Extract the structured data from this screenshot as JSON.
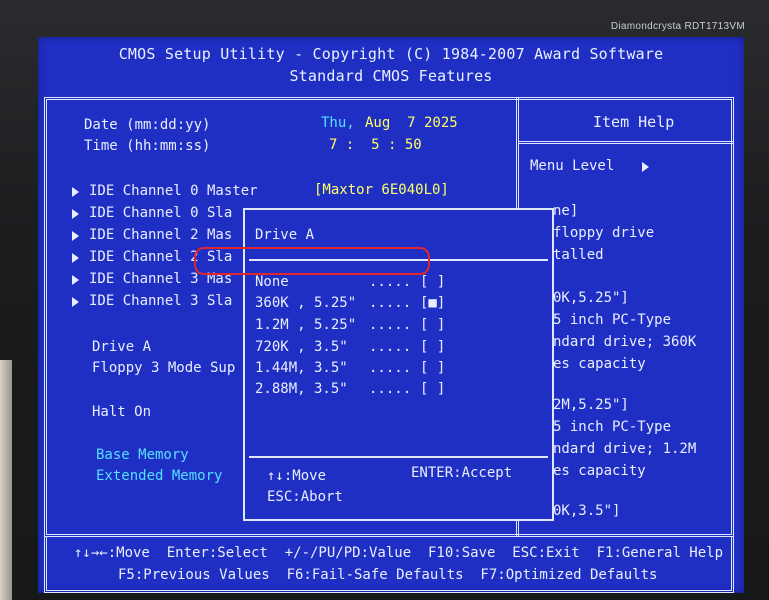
{
  "brand": "Diamondcrysta RDT1713VM",
  "header": {
    "line1": "CMOS Setup Utility - Copyright (C) 1984-2007 Award Software",
    "line2": "Standard CMOS Features"
  },
  "fields": {
    "date_label": "Date (mm:dd:yy)",
    "date_day": "Thu,",
    "date_value": "Aug  7 2025",
    "time_label": "Time (hh:mm:ss)",
    "time_value": "7 :  5 : 50"
  },
  "ide": [
    {
      "label": "IDE Channel 0 Master",
      "value": "[Maxtor 6E040L0]"
    },
    {
      "label": "IDE Channel 0 Sla"
    },
    {
      "label": "IDE Channel 2 Mas"
    },
    {
      "label": "IDE Channel 2 Sla"
    },
    {
      "label": "IDE Channel 3 Mas"
    },
    {
      "label": "IDE Channel 3 Sla"
    }
  ],
  "settings": {
    "drive_a": "Drive A",
    "floppy3": "Floppy 3 Mode Sup",
    "halt_on": "Halt On",
    "base_memory": "Base Memory",
    "extended_memory": "Extended Memory"
  },
  "help": {
    "title": "Item Help",
    "menu_level": "Menu Level",
    "lines": [
      "ne]",
      "floppy drive",
      "talled",
      "0K,5.25\"]",
      "5 inch PC-Type",
      "ndard drive; 360K",
      "es capacity",
      "2M,5.25\"]",
      "5 inch PC-Type",
      "ndard drive; 1.2M",
      "es capacity",
      "0K,3.5\"]"
    ]
  },
  "popup": {
    "title": "Drive A",
    "options": [
      {
        "label": "None",
        "dots": ".....",
        "mark": "[ ]"
      },
      {
        "label": "360K , 5.25\"",
        "dots": ".....",
        "mark": "[■]",
        "selected": true
      },
      {
        "label": "1.2M , 5.25\"",
        "dots": ".....",
        "mark": "[ ]"
      },
      {
        "label": "720K , 3.5\"",
        "dots": ".....",
        "mark": "[ ]"
      },
      {
        "label": "1.44M, 3.5\"",
        "dots": ".....",
        "mark": "[ ]"
      },
      {
        "label": "2.88M, 3.5\"",
        "dots": ".....",
        "mark": "[ ]"
      }
    ],
    "move": "↑↓:Move",
    "accept": "ENTER:Accept",
    "abort": "ESC:Abort"
  },
  "footer": {
    "line1": "↑↓→←:Move  Enter:Select  +/-/PU/PD:Value  F10:Save  ESC:Exit  F1:General Help",
    "line2": "F5:Previous Values  F6:Fail-Safe Defaults  F7:Optimized Defaults"
  },
  "colors": {
    "screen_bg": "#1f2fc4",
    "text": "#e9eeff",
    "value": "#ffff66",
    "cyan": "#55e0ff",
    "highlight": "#e0262e"
  }
}
